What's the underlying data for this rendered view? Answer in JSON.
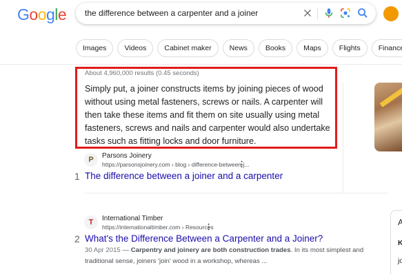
{
  "header": {
    "logo_letters": [
      "G",
      "o",
      "o",
      "g",
      "l",
      "e"
    ],
    "logo_colors": [
      "#4285f4",
      "#ea4335",
      "#fbbc05",
      "#4285f4",
      "#34a853",
      "#ea4335"
    ],
    "query": "the difference between a carpenter and a joiner",
    "icons": [
      "close-icon",
      "microphone-icon",
      "lens-icon",
      "search-icon",
      "avatar"
    ]
  },
  "chips": [
    "Images",
    "Videos",
    "Cabinet maker",
    "News",
    "Books",
    "Maps",
    "Flights",
    "Finance"
  ],
  "featured": {
    "stats": "About 4,960,000 results (0.45 seconds)",
    "snippet": "Simply put, a joiner constructs items by joining pieces of wood without using metal fasteners, screws or nails. A carpenter will then take these items and fit them on site usually using metal fasteners, screws and nails and carpenter would also undertake tasks such as fitting locks and door furniture.",
    "highlight_color": "#e01b1b"
  },
  "results": [
    {
      "rank": "1",
      "favicon": "P",
      "site": "Parsons Joinery",
      "url": "https://parsonsjoinery.com › blog › difference-between-j...",
      "title": "The difference between a joiner and a carpenter"
    },
    {
      "rank": "2",
      "favicon": "T",
      "site": "International Timber",
      "url": "https://internationaltimber.com › Resources",
      "title": "What's the Difference Between a Carpenter and a Joiner?",
      "date": "30 Apr 2015",
      "desc_bold": "Carpentry and joinery are both construction trades",
      "desc_rest": ". In its most simplest and traditional sense, joiners 'join' wood in a workshop, whereas ..."
    }
  ],
  "side_panel": {
    "letters": [
      "A",
      "K",
      "jo"
    ]
  }
}
